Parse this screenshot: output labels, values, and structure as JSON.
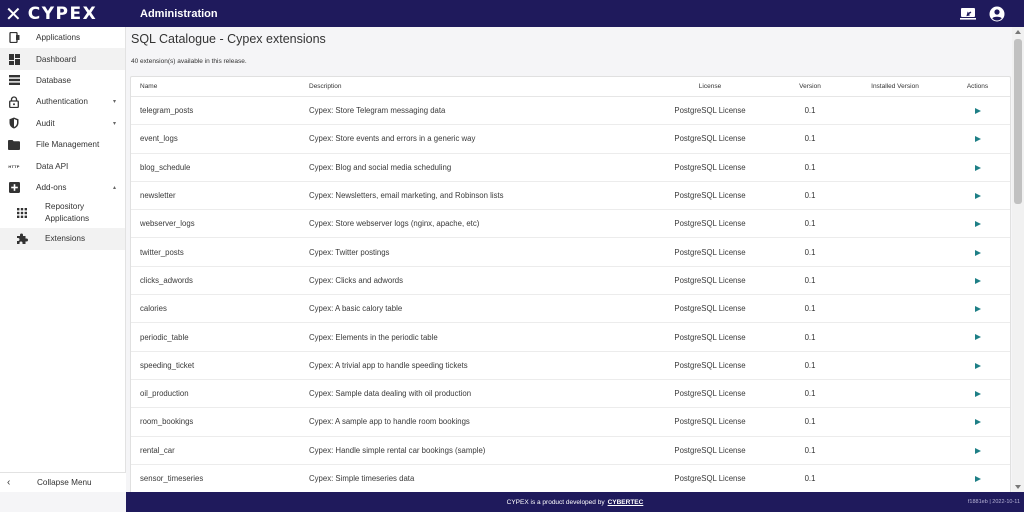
{
  "header": {
    "logo_mark": "✕",
    "logo_text": "CYPEX",
    "title": "Administration",
    "actions": [
      {
        "name": "screen-share-icon"
      },
      {
        "name": "account-circle-icon"
      }
    ]
  },
  "sidebar": {
    "items": [
      {
        "label": "Applications",
        "icon": "applications-icon"
      },
      {
        "label": "Dashboard",
        "icon": "dashboard-icon"
      },
      {
        "label": "Database",
        "icon": "database-icon"
      },
      {
        "label": "Authentication",
        "icon": "lock-icon",
        "chevron": "▾"
      },
      {
        "label": "Audit",
        "icon": "shield-icon",
        "chevron": "▾"
      },
      {
        "label": "File Management",
        "icon": "folder-icon"
      },
      {
        "label": "Data API",
        "icon": "http-icon",
        "icon_text": "HTTP"
      },
      {
        "label": "Add-ons",
        "icon": "add-box-icon",
        "chevron": "▴"
      }
    ],
    "sub_items": [
      {
        "label": "Repository Applications",
        "icon": "grid-icon"
      },
      {
        "label": "Extensions",
        "icon": "puzzle-icon"
      }
    ],
    "collapse_label": "Collapse Menu",
    "collapse_icon": "‹"
  },
  "main": {
    "title": "SQL Catalogue - Cypex extensions",
    "subtitle": "40 extension(s) available in this release.",
    "columns": {
      "name": "Name",
      "description": "Description",
      "license": "License",
      "version": "Version",
      "installed": "Installed Version",
      "actions": "Actions"
    },
    "rows": [
      {
        "name": "telegram_posts",
        "description": "Cypex: Store Telegram messaging data",
        "license": "PostgreSQL License",
        "version": "0.1",
        "installed": ""
      },
      {
        "name": "event_logs",
        "description": "Cypex: Store events and errors in a generic way",
        "license": "PostgreSQL License",
        "version": "0.1",
        "installed": ""
      },
      {
        "name": "blog_schedule",
        "description": "Cypex: Blog and social media scheduling",
        "license": "PostgreSQL License",
        "version": "0.1",
        "installed": ""
      },
      {
        "name": "newsletter",
        "description": "Cypex: Newsletters, email marketing, and Robinson lists",
        "license": "PostgreSQL License",
        "version": "0.1",
        "installed": ""
      },
      {
        "name": "webserver_logs",
        "description": "Cypex: Store webserver logs (nginx, apache, etc)",
        "license": "PostgreSQL License",
        "version": "0.1",
        "installed": ""
      },
      {
        "name": "twitter_posts",
        "description": "Cypex: Twitter postings",
        "license": "PostgreSQL License",
        "version": "0.1",
        "installed": ""
      },
      {
        "name": "clicks_adwords",
        "description": "Cypex: Clicks and adwords",
        "license": "PostgreSQL License",
        "version": "0.1",
        "installed": ""
      },
      {
        "name": "calories",
        "description": "Cypex: A basic calory table",
        "license": "PostgreSQL License",
        "version": "0.1",
        "installed": ""
      },
      {
        "name": "periodic_table",
        "description": "Cypex: Elements in the periodic table",
        "license": "PostgreSQL License",
        "version": "0.1",
        "installed": ""
      },
      {
        "name": "speeding_ticket",
        "description": "Cypex: A trivial app to handle speeding tickets",
        "license": "PostgreSQL License",
        "version": "0.1",
        "installed": ""
      },
      {
        "name": "oil_production",
        "description": "Cypex: Sample data dealing with oil production",
        "license": "PostgreSQL License",
        "version": "0.1",
        "installed": ""
      },
      {
        "name": "room_bookings",
        "description": "Cypex: A sample app to handle room bookings",
        "license": "PostgreSQL License",
        "version": "0.1",
        "installed": ""
      },
      {
        "name": "rental_car",
        "description": "Cypex: Handle simple rental car bookings (sample)",
        "license": "PostgreSQL License",
        "version": "0.1",
        "installed": ""
      },
      {
        "name": "sensor_timeseries",
        "description": "Cypex: Simple timeseries data",
        "license": "PostgreSQL License",
        "version": "0.1",
        "installed": ""
      }
    ],
    "action_icon": "play-icon"
  },
  "footer": {
    "text": "CYPEX is a product developed by",
    "brand": "CYBERTEC",
    "version": "f1881eb | 2022-10-11"
  },
  "colors": {
    "brand_navy": "#1f1a5c",
    "action_teal": "#1e7f86"
  }
}
